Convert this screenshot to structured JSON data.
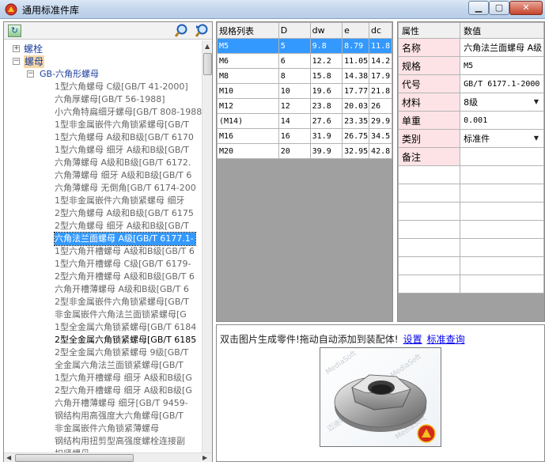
{
  "window": {
    "title": "通用标准件库"
  },
  "tree": {
    "categories": [
      {
        "label": "螺栓",
        "expanded": false
      },
      {
        "label": "螺母",
        "expanded": true
      }
    ],
    "subcategory": "GB-六角形螺母",
    "items": [
      "1型六角螺母 C级[GB/T 41-2000]",
      "六角厚螺母[GB/T 56-1988]",
      "小六角特扁细牙螺母[GB/T 808-1988]",
      "1型非金属嵌件六角锁紧螺母[GB/T",
      "1型六角螺母 A级和B级[GB/T 6170",
      "1型六角螺母 细牙 A级和B级[GB/T",
      "六角薄螺母 A级和B级[GB/T 6172.",
      "六角薄螺母 细牙 A级和B级[GB/T 6",
      "六角薄螺母 无倒角[GB/T 6174-200",
      "1型非金属嵌件六角锁紧螺母 细牙",
      "2型六角螺母 A级和B级[GB/T 6175",
      "2型六角螺母 细牙 A级和B级[GB/T",
      "六角法兰面螺母 A级[GB/T 6177.1-",
      "1型六角开槽螺母 A级和B级[GB/T 6",
      "1型六角开槽螺母 C级[GB/T 6179-",
      "2型六角开槽螺母 A级和B级[GB/T 6",
      "六角开槽薄螺母 A级和B级[GB/T 6",
      "2型非金属嵌件六角锁紧螺母[GB/T",
      "非金属嵌件六角法兰面锁紧螺母[G",
      "1型全金属六角锁紧螺母[GB/T 6184",
      "2型全金属六角锁紧螺母[GB/T 6185",
      "2型全金属六角锁紧螺母 9级[GB/T",
      "全金属六角法兰面锁紧螺母[GB/T",
      "1型六角开槽螺母 细牙 A级和B级[G",
      "2型六角开槽螺母 细牙 A级和B级[G",
      "六角开槽薄螺母 细牙[GB/T 9459-",
      "钢结构用高强度大六角螺母[GB/T",
      "非金属嵌件六角锁紧薄螺母",
      "钢结构用扭剪型高强度螺栓连接副",
      "扣紧螺母"
    ],
    "selected_index": 12,
    "dark_index": 20
  },
  "spec_grid": {
    "columns": [
      "规格列表",
      "D",
      "dw",
      "e",
      "dc"
    ],
    "rows": [
      [
        "M5",
        "5",
        "9.8",
        "8.79",
        "11.8"
      ],
      [
        "M6",
        "6",
        "12.2",
        "11.05",
        "14.2"
      ],
      [
        "M8",
        "8",
        "15.8",
        "14.38",
        "17.9"
      ],
      [
        "M10",
        "10",
        "19.6",
        "17.77",
        "21.8"
      ],
      [
        "M12",
        "12",
        "23.8",
        "20.03",
        "26"
      ],
      [
        "(M14)",
        "14",
        "27.6",
        "23.35",
        "29.9"
      ],
      [
        "M16",
        "16",
        "31.9",
        "26.75",
        "34.5"
      ],
      [
        "M20",
        "20",
        "39.9",
        "32.95",
        "42.8"
      ]
    ],
    "selected_row": 0
  },
  "properties": {
    "columns": [
      "属性",
      "数值"
    ],
    "rows": [
      {
        "key": "名称",
        "value": "六角法兰面螺母 A级",
        "dropdown": false
      },
      {
        "key": "规格",
        "value": "M5",
        "dropdown": false
      },
      {
        "key": "代号",
        "value": "GB/T 6177.1-2000",
        "dropdown": false
      },
      {
        "key": "材料",
        "value": "8级",
        "dropdown": true
      },
      {
        "key": "单重",
        "value": "0.001",
        "dropdown": false
      },
      {
        "key": "类别",
        "value": "标准件",
        "dropdown": true
      },
      {
        "key": "备注",
        "value": "",
        "dropdown": false
      }
    ]
  },
  "preview": {
    "hint": "双击图片生成零件!拖动自动添加到装配体!",
    "link_settings": "设置",
    "link_query": "标准查询",
    "watermark": "MediaSoft",
    "watermark_cn": "迈迪软件"
  },
  "colors": {
    "selection": "#3399ff",
    "property_key_bg": "#fde3e6",
    "tree_text": "#1c3fa0"
  }
}
